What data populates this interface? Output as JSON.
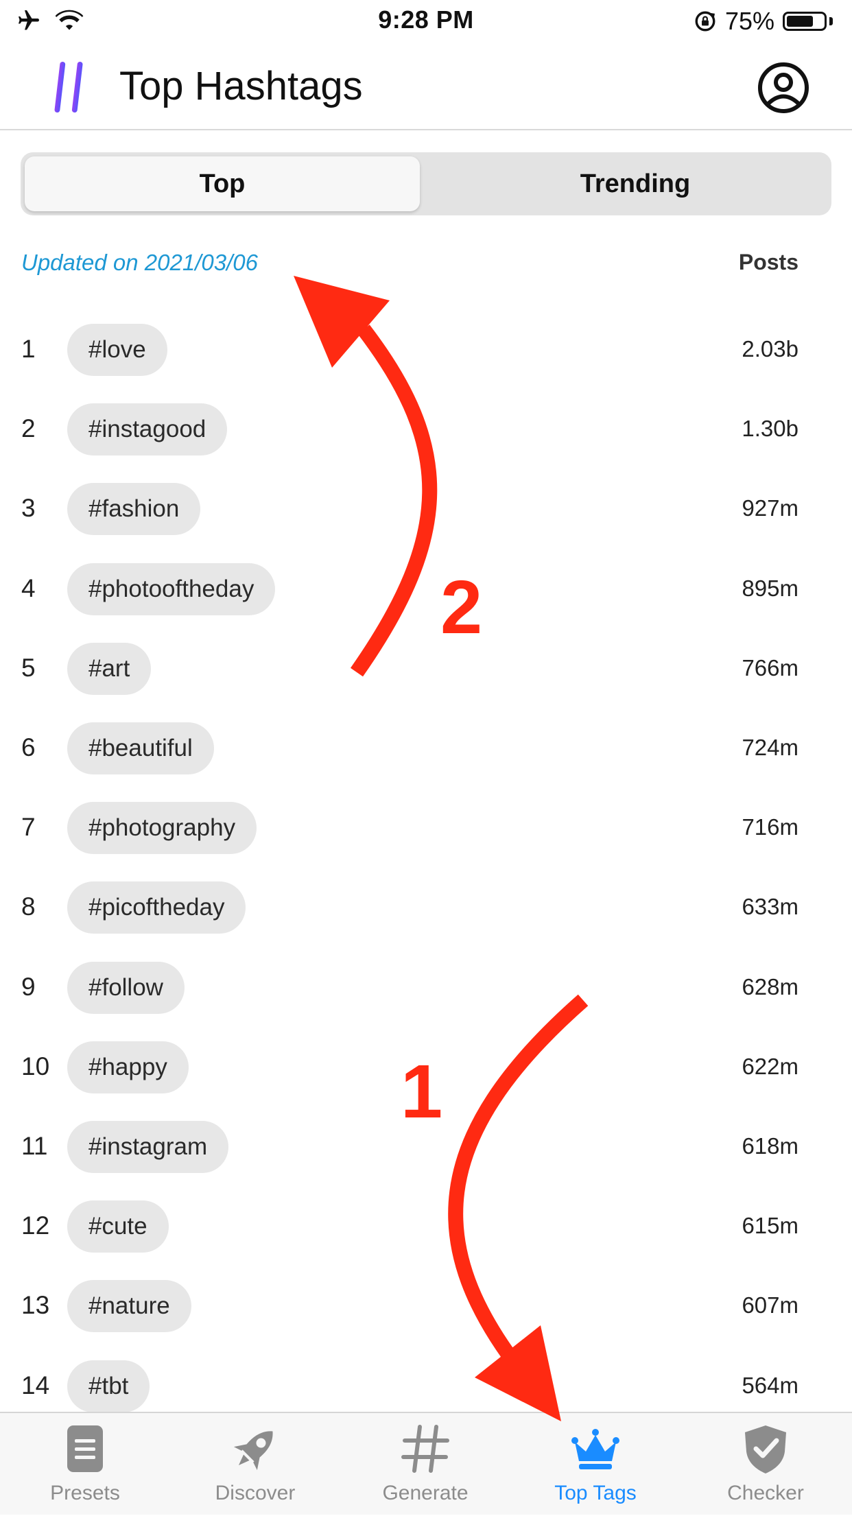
{
  "status_bar": {
    "time": "9:28 PM",
    "battery_percent": "75%",
    "battery_level": 0.75,
    "icons": [
      "airplane-icon",
      "wifi-icon",
      "rotation-lock-icon",
      "battery-icon"
    ]
  },
  "header": {
    "title": "Top Hashtags",
    "logo_icon": "hashtag-gradient-icon",
    "profile_icon": "profile-icon"
  },
  "segmented": {
    "options": [
      "Top",
      "Trending"
    ],
    "selected": "Top"
  },
  "list_header": {
    "updated": "Updated on 2021/03/06",
    "posts": "Posts"
  },
  "hashtags": [
    {
      "rank": "1",
      "tag": "#love",
      "posts": "2.03b"
    },
    {
      "rank": "2",
      "tag": "#instagood",
      "posts": "1.30b"
    },
    {
      "rank": "3",
      "tag": "#fashion",
      "posts": "927m"
    },
    {
      "rank": "4",
      "tag": "#photooftheday",
      "posts": "895m"
    },
    {
      "rank": "5",
      "tag": "#art",
      "posts": "766m"
    },
    {
      "rank": "6",
      "tag": "#beautiful",
      "posts": "724m"
    },
    {
      "rank": "7",
      "tag": "#photography",
      "posts": "716m"
    },
    {
      "rank": "8",
      "tag": "#picoftheday",
      "posts": "633m"
    },
    {
      "rank": "9",
      "tag": "#follow",
      "posts": "628m"
    },
    {
      "rank": "10",
      "tag": "#happy",
      "posts": "622m"
    },
    {
      "rank": "11",
      "tag": "#instagram",
      "posts": "618m"
    },
    {
      "rank": "12",
      "tag": "#cute",
      "posts": "615m"
    },
    {
      "rank": "13",
      "tag": "#nature",
      "posts": "607m"
    },
    {
      "rank": "14",
      "tag": "#tbt",
      "posts": "564m"
    }
  ],
  "tab_bar": {
    "tabs": [
      {
        "label": "Presets",
        "icon": "document-icon"
      },
      {
        "label": "Discover",
        "icon": "rocket-icon"
      },
      {
        "label": "Generate",
        "icon": "hashtag-icon"
      },
      {
        "label": "Top Tags",
        "icon": "crown-icon"
      },
      {
        "label": "Checker",
        "icon": "shield-check-icon"
      }
    ],
    "active": "Top Tags"
  },
  "annotations": {
    "labels": [
      "1",
      "2"
    ],
    "color": "#ff2a12"
  },
  "colors": {
    "accent": "#1a8cff",
    "updated_text": "#1e98d4",
    "logo_gradient": [
      "#b23cf0",
      "#3b5bff"
    ]
  }
}
